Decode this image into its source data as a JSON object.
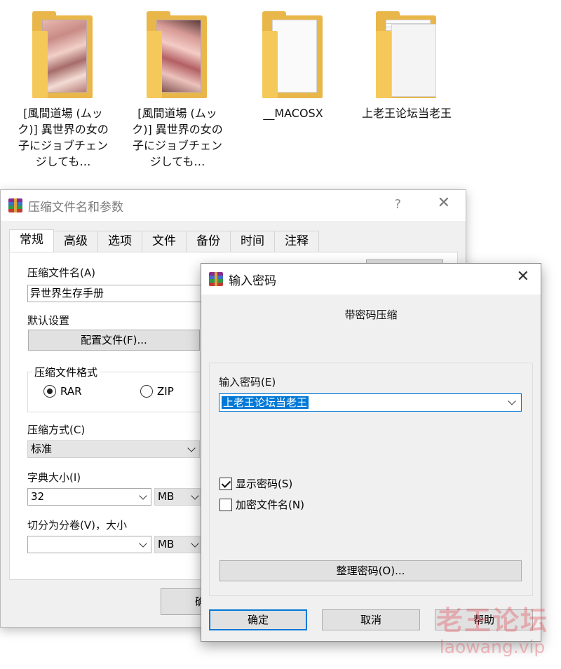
{
  "desktop": {
    "folders": [
      {
        "label": "[風間道場 (ムック)] 異世界の女の子にジョブチェンジしても…",
        "thumbnail": "manga-pages"
      },
      {
        "label": "[風間道場 (ムック)] 異世界の女の子にジョブチェンジしても…",
        "thumbnail": "manga-pages"
      },
      {
        "label": "__MACOSX",
        "thumbnail": "blank-document"
      },
      {
        "label": "上老王论坛当老王",
        "thumbnail": "text-documents"
      }
    ]
  },
  "archive_dialog": {
    "title": "压缩文件名和参数",
    "help_glyph": "?",
    "close_glyph": "✕",
    "tabs": [
      "常规",
      "高级",
      "选项",
      "文件",
      "备份",
      "时间",
      "注释"
    ],
    "active_tab": "常规",
    "archive_name_label": "压缩文件名(A)",
    "archive_name_value": "异世界生存手册",
    "default_settings_label": "默认设置",
    "profiles_button": "配置文件(F)...",
    "format_group_label": "压缩文件格式",
    "format_rar": "RAR",
    "format_zip": "ZIP",
    "selected_format": "RAR",
    "method_label": "压缩方式(C)",
    "method_value": "标准",
    "dict_label": "字典大小(I)",
    "dict_value": "32",
    "dict_unit": "MB",
    "split_label": "切分为分卷(V)，大小",
    "split_value": "",
    "split_unit": "MB",
    "ok_button_partial": "确"
  },
  "password_dialog": {
    "title": "输入密码",
    "close_glyph": "✕",
    "caption": "带密码压缩",
    "password_label": "输入密码(E)",
    "password_value": "上老王论坛当老王",
    "show_password_label": "显示密码(S)",
    "show_password_checked": true,
    "encrypt_names_label": "加密文件名(N)",
    "encrypt_names_checked": false,
    "organize_button": "整理密码(O)...",
    "ok_button": "确定",
    "cancel_button": "取消",
    "help_button": "帮助"
  },
  "watermark": {
    "cn": "老王论坛",
    "en": "laowang.vip"
  }
}
